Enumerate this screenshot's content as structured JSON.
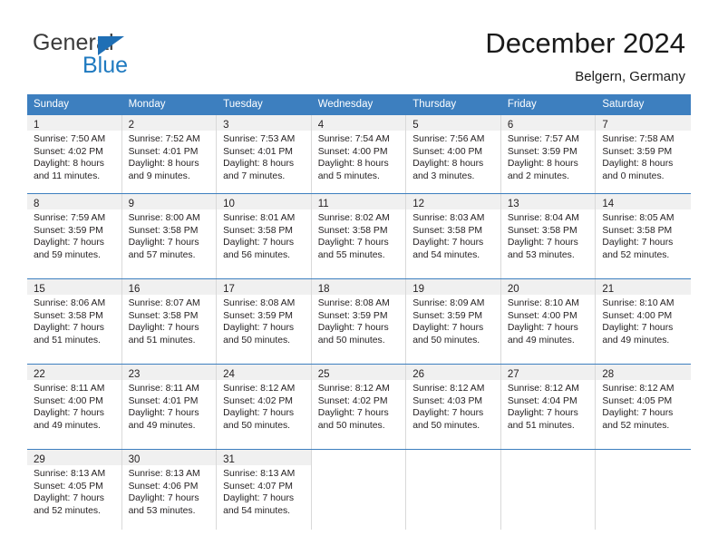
{
  "brand": {
    "name_part1": "General",
    "name_part2": "Blue",
    "accent_color": "#1f7ac0"
  },
  "header": {
    "title": "December 2024",
    "subtitle": "Belgern, Germany"
  },
  "calendar": {
    "header_color": "#3d7fbf",
    "weekdays": [
      "Sunday",
      "Monday",
      "Tuesday",
      "Wednesday",
      "Thursday",
      "Friday",
      "Saturday"
    ],
    "weeks": [
      [
        {
          "day": "1",
          "sunrise": "Sunrise: 7:50 AM",
          "sunset": "Sunset: 4:02 PM",
          "daylight1": "Daylight: 8 hours",
          "daylight2": "and 11 minutes."
        },
        {
          "day": "2",
          "sunrise": "Sunrise: 7:52 AM",
          "sunset": "Sunset: 4:01 PM",
          "daylight1": "Daylight: 8 hours",
          "daylight2": "and 9 minutes."
        },
        {
          "day": "3",
          "sunrise": "Sunrise: 7:53 AM",
          "sunset": "Sunset: 4:01 PM",
          "daylight1": "Daylight: 8 hours",
          "daylight2": "and 7 minutes."
        },
        {
          "day": "4",
          "sunrise": "Sunrise: 7:54 AM",
          "sunset": "Sunset: 4:00 PM",
          "daylight1": "Daylight: 8 hours",
          "daylight2": "and 5 minutes."
        },
        {
          "day": "5",
          "sunrise": "Sunrise: 7:56 AM",
          "sunset": "Sunset: 4:00 PM",
          "daylight1": "Daylight: 8 hours",
          "daylight2": "and 3 minutes."
        },
        {
          "day": "6",
          "sunrise": "Sunrise: 7:57 AM",
          "sunset": "Sunset: 3:59 PM",
          "daylight1": "Daylight: 8 hours",
          "daylight2": "and 2 minutes."
        },
        {
          "day": "7",
          "sunrise": "Sunrise: 7:58 AM",
          "sunset": "Sunset: 3:59 PM",
          "daylight1": "Daylight: 8 hours",
          "daylight2": "and 0 minutes."
        }
      ],
      [
        {
          "day": "8",
          "sunrise": "Sunrise: 7:59 AM",
          "sunset": "Sunset: 3:59 PM",
          "daylight1": "Daylight: 7 hours",
          "daylight2": "and 59 minutes."
        },
        {
          "day": "9",
          "sunrise": "Sunrise: 8:00 AM",
          "sunset": "Sunset: 3:58 PM",
          "daylight1": "Daylight: 7 hours",
          "daylight2": "and 57 minutes."
        },
        {
          "day": "10",
          "sunrise": "Sunrise: 8:01 AM",
          "sunset": "Sunset: 3:58 PM",
          "daylight1": "Daylight: 7 hours",
          "daylight2": "and 56 minutes."
        },
        {
          "day": "11",
          "sunrise": "Sunrise: 8:02 AM",
          "sunset": "Sunset: 3:58 PM",
          "daylight1": "Daylight: 7 hours",
          "daylight2": "and 55 minutes."
        },
        {
          "day": "12",
          "sunrise": "Sunrise: 8:03 AM",
          "sunset": "Sunset: 3:58 PM",
          "daylight1": "Daylight: 7 hours",
          "daylight2": "and 54 minutes."
        },
        {
          "day": "13",
          "sunrise": "Sunrise: 8:04 AM",
          "sunset": "Sunset: 3:58 PM",
          "daylight1": "Daylight: 7 hours",
          "daylight2": "and 53 minutes."
        },
        {
          "day": "14",
          "sunrise": "Sunrise: 8:05 AM",
          "sunset": "Sunset: 3:58 PM",
          "daylight1": "Daylight: 7 hours",
          "daylight2": "and 52 minutes."
        }
      ],
      [
        {
          "day": "15",
          "sunrise": "Sunrise: 8:06 AM",
          "sunset": "Sunset: 3:58 PM",
          "daylight1": "Daylight: 7 hours",
          "daylight2": "and 51 minutes."
        },
        {
          "day": "16",
          "sunrise": "Sunrise: 8:07 AM",
          "sunset": "Sunset: 3:58 PM",
          "daylight1": "Daylight: 7 hours",
          "daylight2": "and 51 minutes."
        },
        {
          "day": "17",
          "sunrise": "Sunrise: 8:08 AM",
          "sunset": "Sunset: 3:59 PM",
          "daylight1": "Daylight: 7 hours",
          "daylight2": "and 50 minutes."
        },
        {
          "day": "18",
          "sunrise": "Sunrise: 8:08 AM",
          "sunset": "Sunset: 3:59 PM",
          "daylight1": "Daylight: 7 hours",
          "daylight2": "and 50 minutes."
        },
        {
          "day": "19",
          "sunrise": "Sunrise: 8:09 AM",
          "sunset": "Sunset: 3:59 PM",
          "daylight1": "Daylight: 7 hours",
          "daylight2": "and 50 minutes."
        },
        {
          "day": "20",
          "sunrise": "Sunrise: 8:10 AM",
          "sunset": "Sunset: 4:00 PM",
          "daylight1": "Daylight: 7 hours",
          "daylight2": "and 49 minutes."
        },
        {
          "day": "21",
          "sunrise": "Sunrise: 8:10 AM",
          "sunset": "Sunset: 4:00 PM",
          "daylight1": "Daylight: 7 hours",
          "daylight2": "and 49 minutes."
        }
      ],
      [
        {
          "day": "22",
          "sunrise": "Sunrise: 8:11 AM",
          "sunset": "Sunset: 4:00 PM",
          "daylight1": "Daylight: 7 hours",
          "daylight2": "and 49 minutes."
        },
        {
          "day": "23",
          "sunrise": "Sunrise: 8:11 AM",
          "sunset": "Sunset: 4:01 PM",
          "daylight1": "Daylight: 7 hours",
          "daylight2": "and 49 minutes."
        },
        {
          "day": "24",
          "sunrise": "Sunrise: 8:12 AM",
          "sunset": "Sunset: 4:02 PM",
          "daylight1": "Daylight: 7 hours",
          "daylight2": "and 50 minutes."
        },
        {
          "day": "25",
          "sunrise": "Sunrise: 8:12 AM",
          "sunset": "Sunset: 4:02 PM",
          "daylight1": "Daylight: 7 hours",
          "daylight2": "and 50 minutes."
        },
        {
          "day": "26",
          "sunrise": "Sunrise: 8:12 AM",
          "sunset": "Sunset: 4:03 PM",
          "daylight1": "Daylight: 7 hours",
          "daylight2": "and 50 minutes."
        },
        {
          "day": "27",
          "sunrise": "Sunrise: 8:12 AM",
          "sunset": "Sunset: 4:04 PM",
          "daylight1": "Daylight: 7 hours",
          "daylight2": "and 51 minutes."
        },
        {
          "day": "28",
          "sunrise": "Sunrise: 8:12 AM",
          "sunset": "Sunset: 4:05 PM",
          "daylight1": "Daylight: 7 hours",
          "daylight2": "and 52 minutes."
        }
      ],
      [
        {
          "day": "29",
          "sunrise": "Sunrise: 8:13 AM",
          "sunset": "Sunset: 4:05 PM",
          "daylight1": "Daylight: 7 hours",
          "daylight2": "and 52 minutes."
        },
        {
          "day": "30",
          "sunrise": "Sunrise: 8:13 AM",
          "sunset": "Sunset: 4:06 PM",
          "daylight1": "Daylight: 7 hours",
          "daylight2": "and 53 minutes."
        },
        {
          "day": "31",
          "sunrise": "Sunrise: 8:13 AM",
          "sunset": "Sunset: 4:07 PM",
          "daylight1": "Daylight: 7 hours",
          "daylight2": "and 54 minutes."
        },
        {
          "day": "",
          "sunrise": "",
          "sunset": "",
          "daylight1": "",
          "daylight2": ""
        },
        {
          "day": "",
          "sunrise": "",
          "sunset": "",
          "daylight1": "",
          "daylight2": ""
        },
        {
          "day": "",
          "sunrise": "",
          "sunset": "",
          "daylight1": "",
          "daylight2": ""
        },
        {
          "day": "",
          "sunrise": "",
          "sunset": "",
          "daylight1": "",
          "daylight2": ""
        }
      ]
    ]
  }
}
